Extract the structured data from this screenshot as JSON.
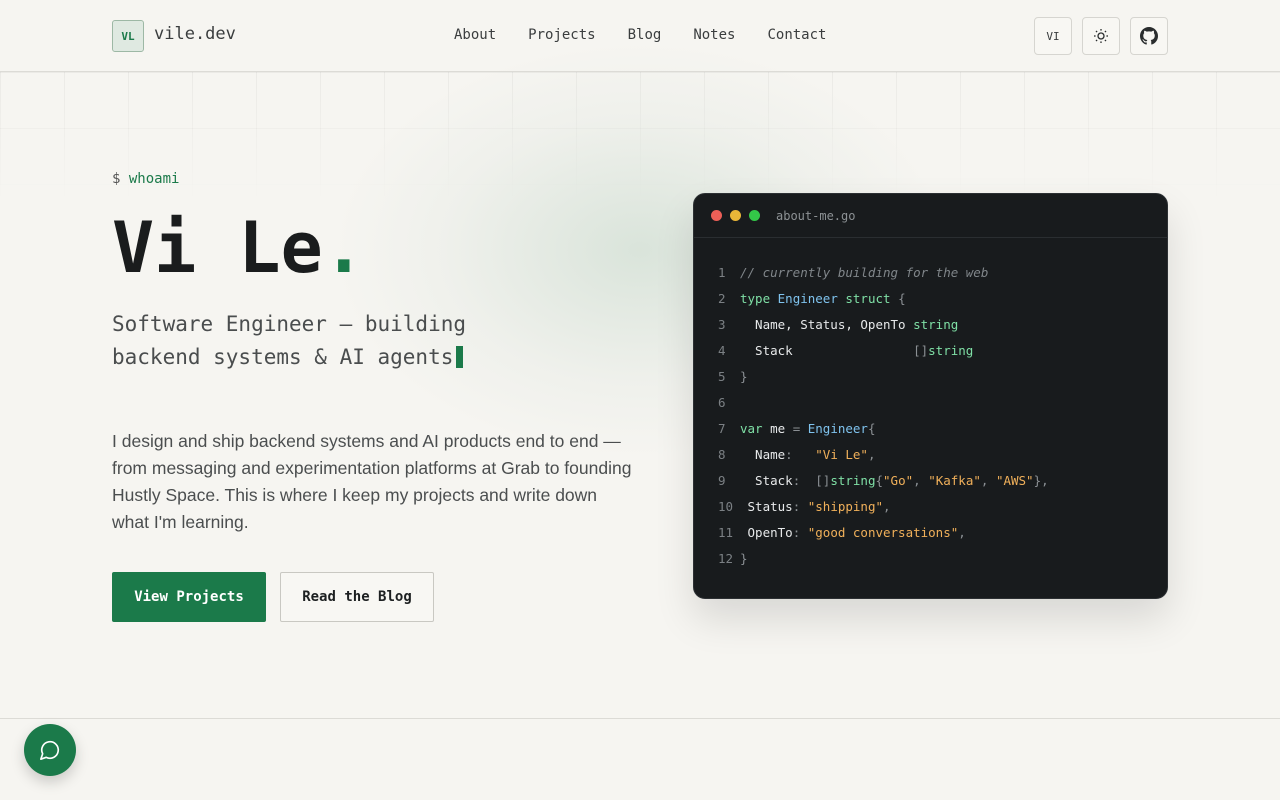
{
  "brand": {
    "badge": "VL",
    "name": "vile.dev"
  },
  "nav": [
    "About",
    "Projects",
    "Blog",
    "Notes",
    "Contact"
  ],
  "header_actions": {
    "lang": "VI",
    "theme_icon": "sun-icon",
    "github_icon": "github-icon"
  },
  "hero": {
    "prompt_symbol": "$",
    "prompt_cmd": "whoami",
    "name": "Vi Le",
    "name_dot": ".",
    "subtitle": "Software Engineer — building backend systems & AI agents",
    "bio": "I design and ship backend systems and AI products end to end — from messaging and experimentation platforms at Grab to founding Hustly Space. This is where I keep my projects and write down what I'm learning.",
    "primary_button": "View Projects",
    "secondary_button": "Read the Blog"
  },
  "code": {
    "filename": "about-me.go",
    "lines": [
      {
        "n": "1",
        "tokens": [
          [
            "cm",
            "// currently building for the web"
          ]
        ]
      },
      {
        "n": "2",
        "tokens": [
          [
            "kw",
            "type "
          ],
          [
            "ty",
            "Engineer "
          ],
          [
            "kw",
            "struct "
          ],
          [
            "pu",
            "{"
          ]
        ]
      },
      {
        "n": "3",
        "tokens": [
          [
            "ct",
            "  Name, Status, OpenTo "
          ],
          [
            "kw",
            "string"
          ]
        ]
      },
      {
        "n": "4",
        "tokens": [
          [
            "ct",
            "  Stack                "
          ],
          [
            "pu",
            "[]"
          ],
          [
            "kw",
            "string"
          ]
        ]
      },
      {
        "n": "5",
        "tokens": [
          [
            "pu",
            "}"
          ]
        ]
      },
      {
        "n": "6",
        "tokens": []
      },
      {
        "n": "7",
        "tokens": [
          [
            "kw",
            "var "
          ],
          [
            "ct",
            "me "
          ],
          [
            "pu",
            "= "
          ],
          [
            "ty",
            "Engineer"
          ],
          [
            "pu",
            "{"
          ]
        ]
      },
      {
        "n": "8",
        "tokens": [
          [
            "ct",
            "  Name"
          ],
          [
            "pu",
            ":   "
          ],
          [
            "st",
            "\"Vi Le\""
          ],
          [
            "pu",
            ","
          ]
        ]
      },
      {
        "n": "9",
        "tokens": [
          [
            "ct",
            "  Stack"
          ],
          [
            "pu",
            ":  []"
          ],
          [
            "kw",
            "string"
          ],
          [
            "pu",
            "{"
          ],
          [
            "st",
            "\"Go\""
          ],
          [
            "pu",
            ", "
          ],
          [
            "st",
            "\"Kafka\""
          ],
          [
            "pu",
            ", "
          ],
          [
            "st",
            "\"AWS\""
          ],
          [
            "pu",
            "},"
          ]
        ]
      },
      {
        "n": "10",
        "tokens": [
          [
            "ct",
            " Status"
          ],
          [
            "pu",
            ": "
          ],
          [
            "st",
            "\"shipping\""
          ],
          [
            "pu",
            ","
          ]
        ]
      },
      {
        "n": "11",
        "tokens": [
          [
            "ct",
            " OpenTo"
          ],
          [
            "pu",
            ": "
          ],
          [
            "st",
            "\"good conversations\""
          ],
          [
            "pu",
            ","
          ]
        ]
      },
      {
        "n": "12",
        "tokens": [
          [
            "pu",
            "}"
          ]
        ]
      }
    ]
  },
  "chat_icon": "chat-bubble-icon",
  "colors": {
    "accent": "#1b7a4a",
    "background": "#f6f5f1",
    "code_bg": "#181b1d"
  }
}
